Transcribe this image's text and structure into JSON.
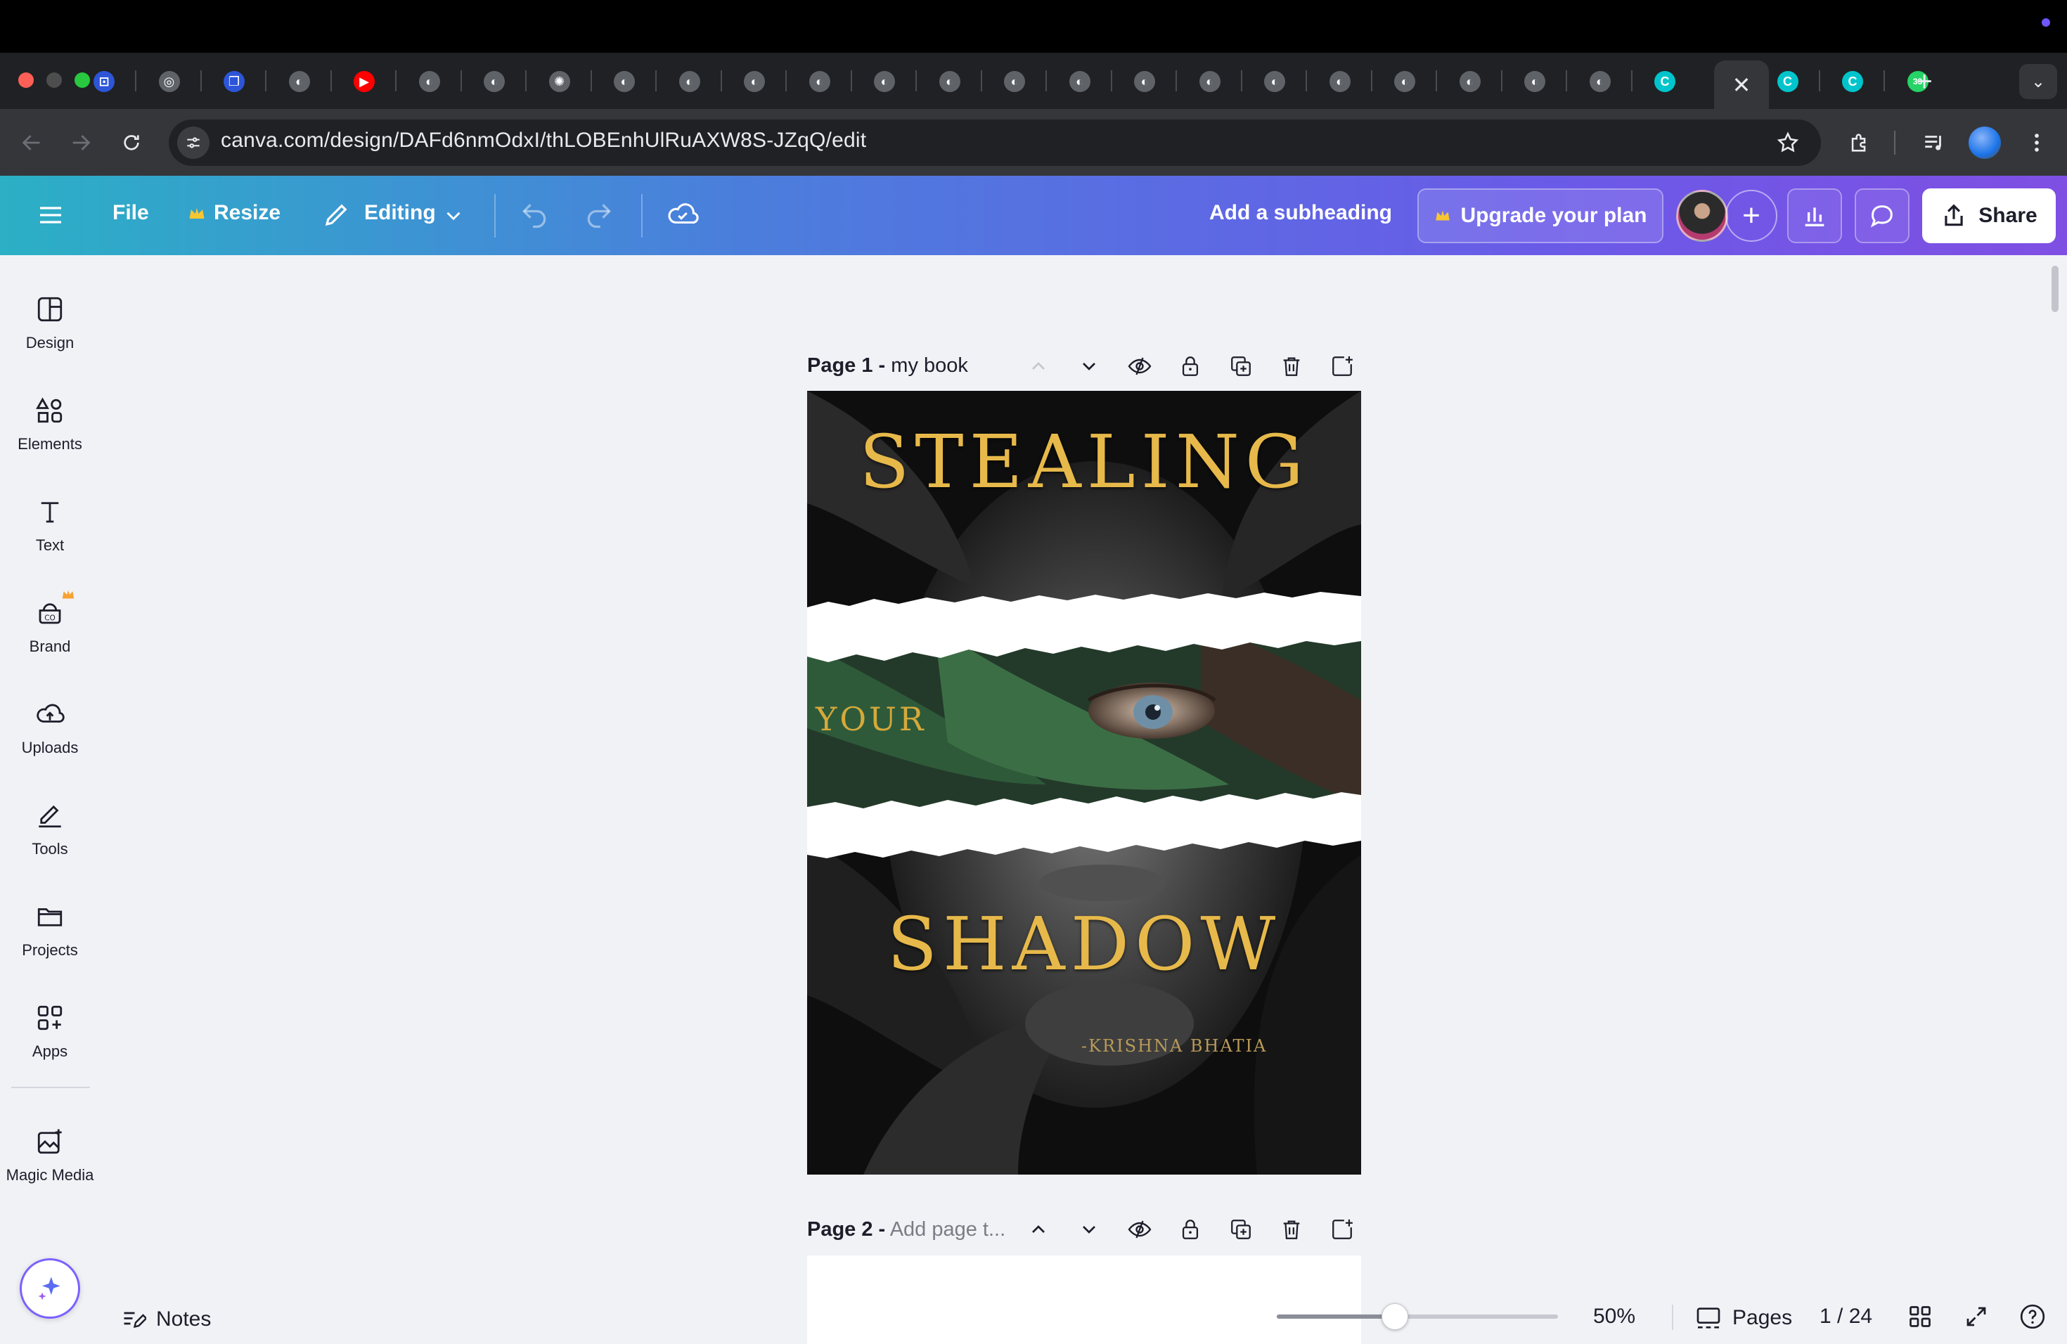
{
  "browser": {
    "url": "canva.com/design/DAFd6nmOdxI/thLOBEnhUlRuAXW8S-JZqQ/edit",
    "active_tab_close": "✕",
    "new_tab": "+",
    "tab_search": "⌄",
    "tabs": [
      {
        "icon": "generic-site-icon",
        "color": "#2d55d8",
        "glyph": "⊡"
      },
      {
        "icon": "chrome-icon",
        "color": "#5f6368",
        "glyph": "◎"
      },
      {
        "icon": "generic-site-icon",
        "color": "#2d55d8",
        "glyph": "❐"
      },
      {
        "icon": "globe-icon",
        "color": "#5f6368",
        "glyph": "◐"
      },
      {
        "icon": "youtube-icon",
        "color": "#ff0000",
        "glyph": "▶"
      },
      {
        "icon": "globe-icon",
        "color": "#5f6368",
        "glyph": "◐"
      },
      {
        "icon": "globe-icon",
        "color": "#5f6368",
        "glyph": "◐"
      },
      {
        "icon": "openai-icon",
        "color": "#5f6368",
        "glyph": "✺"
      },
      {
        "icon": "globe-icon",
        "color": "#5f6368",
        "glyph": "◐"
      },
      {
        "icon": "globe-icon",
        "color": "#5f6368",
        "glyph": "◐"
      },
      {
        "icon": "globe-icon",
        "color": "#5f6368",
        "glyph": "◐"
      },
      {
        "icon": "globe-icon",
        "color": "#5f6368",
        "glyph": "◐"
      },
      {
        "icon": "globe-icon",
        "color": "#5f6368",
        "glyph": "◐"
      },
      {
        "icon": "globe-icon",
        "color": "#5f6368",
        "glyph": "◐"
      },
      {
        "icon": "globe-icon",
        "color": "#5f6368",
        "glyph": "◐"
      },
      {
        "icon": "globe-icon",
        "color": "#5f6368",
        "glyph": "◐"
      },
      {
        "icon": "globe-icon",
        "color": "#5f6368",
        "glyph": "◐"
      },
      {
        "icon": "globe-icon",
        "color": "#5f6368",
        "glyph": "◐"
      },
      {
        "icon": "globe-icon",
        "color": "#5f6368",
        "glyph": "◐"
      },
      {
        "icon": "globe-icon",
        "color": "#5f6368",
        "glyph": "◐"
      },
      {
        "icon": "globe-icon",
        "color": "#5f6368",
        "glyph": "◐"
      },
      {
        "icon": "globe-icon",
        "color": "#5f6368",
        "glyph": "◐"
      },
      {
        "icon": "globe-icon",
        "color": "#5f6368",
        "glyph": "◐"
      },
      {
        "icon": "globe-icon",
        "color": "#5f6368",
        "glyph": "◐"
      },
      {
        "icon": "canva-icon",
        "color": "#00c4cc",
        "glyph": "C"
      },
      {
        "icon": "canva-icon",
        "color": "#00c4cc",
        "glyph": "C"
      },
      {
        "icon": "canva-icon",
        "color": "#00c4cc",
        "glyph": "C"
      },
      {
        "icon": "whatsapp-icon",
        "color": "#25d366",
        "glyph": "33"
      }
    ]
  },
  "header": {
    "file": "File",
    "resize": "Resize",
    "mode": "Editing",
    "subheading": "Add a subheading",
    "upgrade": "Upgrade your plan",
    "share": "Share",
    "accent": "#7d2ae8"
  },
  "sidebar": {
    "items": [
      {
        "label": "Design",
        "icon": "design-icon"
      },
      {
        "label": "Elements",
        "icon": "elements-icon"
      },
      {
        "label": "Text",
        "icon": "text-icon"
      },
      {
        "label": "Brand",
        "icon": "brand-icon"
      },
      {
        "label": "Uploads",
        "icon": "uploads-icon"
      },
      {
        "label": "Tools",
        "icon": "tools-icon"
      },
      {
        "label": "Projects",
        "icon": "projects-icon"
      },
      {
        "label": "Apps",
        "icon": "apps-icon"
      },
      {
        "label": "Magic Media",
        "icon": "magic-media-icon"
      }
    ]
  },
  "canvas": {
    "page1": {
      "number": "Page 1 -",
      "title": "my book"
    },
    "page2": {
      "number": "Page 2 -",
      "title_placeholder": "Add page t..."
    },
    "cover": {
      "title_top": "Stealing",
      "title_mid": "your",
      "title_bottom": "Shadow",
      "author": "-Krishna Bhatia"
    }
  },
  "footer": {
    "notes": "Notes",
    "zoom": "50%",
    "zoom_fraction": 0.42,
    "pages": "Pages",
    "page_indicator": "1 / 24"
  }
}
